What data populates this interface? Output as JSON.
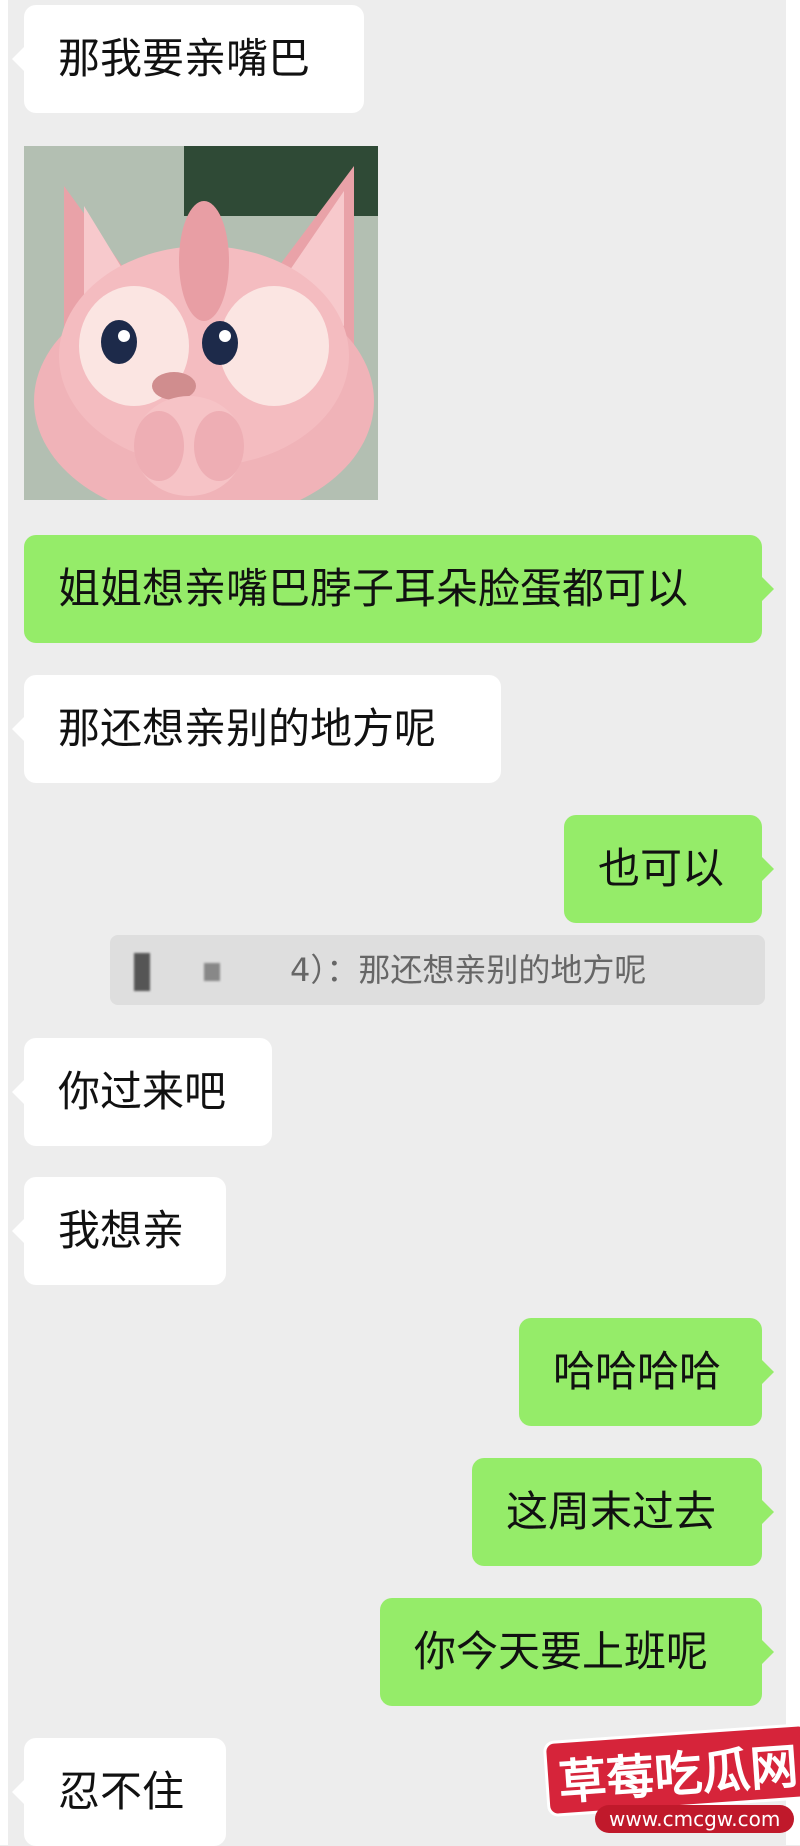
{
  "messages": {
    "m1": "那我要亲嘴巴",
    "m2": "姐姐想亲嘴巴脖子耳朵脸蛋都可以",
    "m3": "那还想亲别的地方呢",
    "m4": "也可以",
    "quote": {
      "fragment": "4）：",
      "text": "那还想亲别的地方呢"
    },
    "m5": "你过来吧",
    "m6": "我想亲",
    "m7": "哈哈哈哈",
    "m8": "这周末过去",
    "m9": "你今天要上班呢",
    "m10": "忍不住"
  },
  "sticker": {
    "icon": "pink-fox-plush-sticker",
    "colors": {
      "fur": "#f1b5b8",
      "bg": "#a9b6a8"
    }
  },
  "watermark": {
    "title": "草莓吃瓜网",
    "url": "www.cmcgw.com",
    "color": "#d6243a"
  },
  "colors": {
    "background": "#ededed",
    "incoming_bubble": "#ffffff",
    "outgoing_bubble": "#95ec69"
  }
}
